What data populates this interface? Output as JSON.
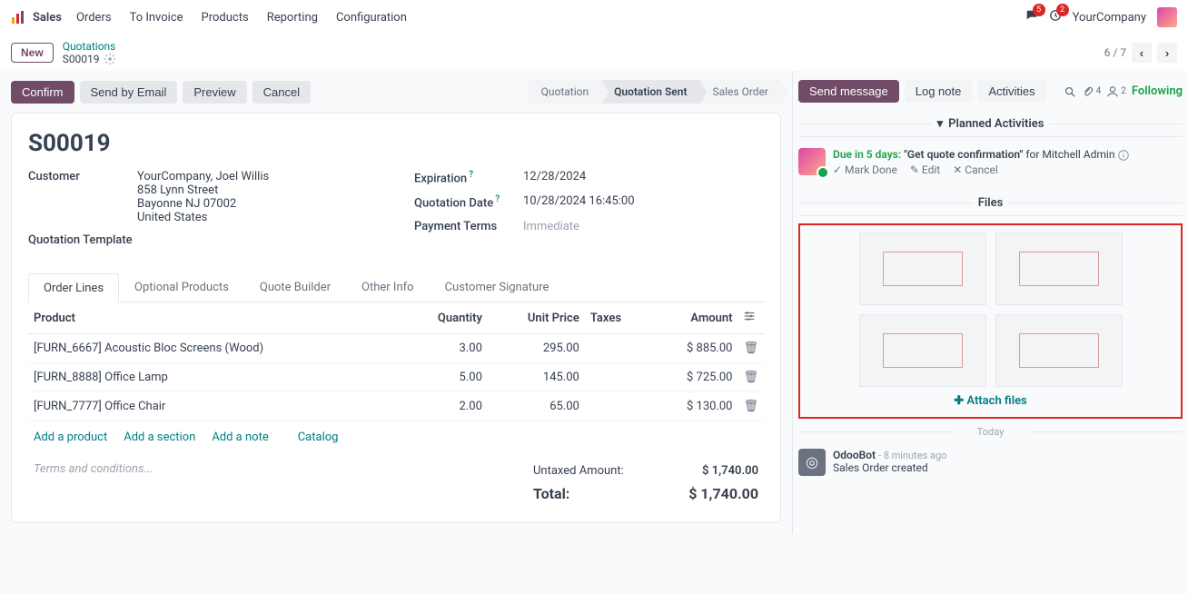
{
  "topbar": {
    "app": "Sales",
    "nav": [
      "Orders",
      "To Invoice",
      "Products",
      "Reporting",
      "Configuration"
    ],
    "chat_badge": "5",
    "clock_badge": "2",
    "company": "YourCompany"
  },
  "breadcrumb": {
    "new": "New",
    "parent": "Quotations",
    "current": "S00019"
  },
  "pager": {
    "text": "6 / 7"
  },
  "actions": {
    "confirm": "Confirm",
    "send_email": "Send by Email",
    "preview": "Preview",
    "cancel": "Cancel"
  },
  "status": {
    "quotation": "Quotation",
    "quotation_sent": "Quotation Sent",
    "sales_order": "Sales Order"
  },
  "form": {
    "title": "S00019",
    "customer_label": "Customer",
    "customer_name": "YourCompany, Joel Willis",
    "addr1": "858 Lynn Street",
    "addr2": "Bayonne NJ 07002",
    "addr3": "United States",
    "template_label": "Quotation Template",
    "expiration_label": "Expiration",
    "expiration": "12/28/2024",
    "quotation_date_label": "Quotation Date",
    "quotation_date": "10/28/2024 16:45:00",
    "payment_terms_label": "Payment Terms",
    "payment_terms": "Immediate"
  },
  "tabs": [
    "Order Lines",
    "Optional Products",
    "Quote Builder",
    "Other Info",
    "Customer Signature"
  ],
  "cols": {
    "product": "Product",
    "quantity": "Quantity",
    "unit_price": "Unit Price",
    "taxes": "Taxes",
    "amount": "Amount"
  },
  "lines": [
    {
      "product": "[FURN_6667] Acoustic Bloc Screens (Wood)",
      "qty": "3.00",
      "price": "295.00",
      "amount": "$ 885.00"
    },
    {
      "product": "[FURN_8888] Office Lamp",
      "qty": "5.00",
      "price": "145.00",
      "amount": "$ 725.00"
    },
    {
      "product": "[FURN_7777] Office Chair",
      "qty": "2.00",
      "price": "65.00",
      "amount": "$ 130.00"
    }
  ],
  "line_actions": {
    "add_product": "Add a product",
    "add_section": "Add a section",
    "add_note": "Add a note",
    "catalog": "Catalog"
  },
  "terms_placeholder": "Terms and conditions...",
  "totals": {
    "untaxed_label": "Untaxed Amount:",
    "untaxed": "$ 1,740.00",
    "total_label": "Total:",
    "total": "$ 1,740.00"
  },
  "chatter": {
    "send_message": "Send message",
    "log_note": "Log note",
    "activities": "Activities",
    "attachments": "4",
    "followers": "2",
    "following": "Following",
    "planned_header": "Planned Activities",
    "activity": {
      "due": "Due in 5 days:",
      "title": "\"Get quote confirmation\"",
      "for": "for Mitchell Admin",
      "mark_done": "Mark Done",
      "edit": "Edit",
      "cancel": "Cancel"
    },
    "files_header": "Files",
    "attach_files": "Attach files",
    "today": "Today",
    "log": {
      "author": "OdooBot",
      "time": "- 8 minutes ago",
      "msg": "Sales Order created"
    }
  }
}
